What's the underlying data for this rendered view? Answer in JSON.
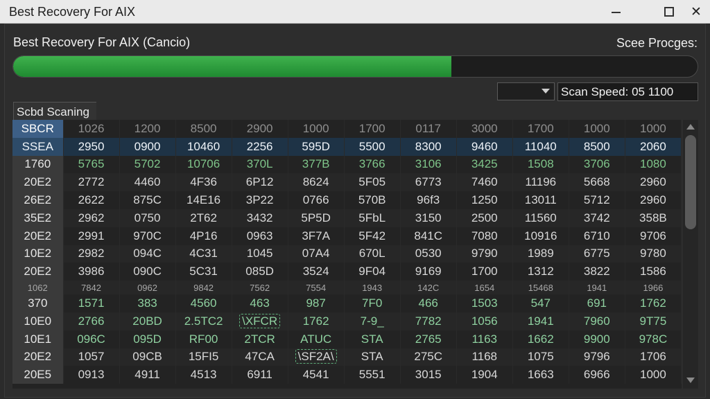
{
  "window": {
    "title": "Best Recovery For AIX",
    "controls": {
      "minimize": "minimize-icon",
      "maximize": "maximize-icon",
      "close": "close-icon"
    }
  },
  "header": {
    "app_title": "Best Recovery For AIX (Cancio)",
    "progress_label": "Scee Procges:",
    "progress_fraction": 0.64
  },
  "controls": {
    "speed_select_value": "",
    "scan_speed": "Scan Speed: 05  1100"
  },
  "section": {
    "label": "Scbd Scaning"
  },
  "grid": {
    "rows": [
      [
        "SBCR",
        "1026",
        "1200",
        "8500",
        "2900",
        "1000",
        "1700",
        "0117",
        "3000",
        "1700",
        "1000",
        "1000"
      ],
      [
        "SSEA",
        "2950",
        "0900",
        "10460",
        "2256",
        "595D",
        "5500",
        "8300",
        "9460",
        "11040",
        "8500",
        "2060"
      ],
      [
        "1760",
        "5765",
        "5702",
        "10706",
        "370L",
        "377B",
        "3766",
        "3106",
        "3425",
        "1508",
        "3706",
        "1080"
      ],
      [
        "20E2",
        "2772",
        "4460",
        "4F36",
        "6P12",
        "8624",
        "5F05",
        "6773",
        "7460",
        "11196",
        "5668",
        "2960"
      ],
      [
        "26E2",
        "2622",
        "875C",
        "14E16",
        "3P22",
        "0766",
        "570B",
        "96f3",
        "1250",
        "13011",
        "5712",
        "2960"
      ],
      [
        "35E2",
        "2962",
        "0750",
        "2T62",
        "3432",
        "5P5D",
        "5FbL",
        "3150",
        "2500",
        "11560",
        "3742",
        "358B"
      ],
      [
        "20E2",
        "2991",
        "970C",
        "4P16",
        "0963",
        "3F7A",
        "5F42",
        "841C",
        "7080",
        "10916",
        "6710",
        "9706"
      ],
      [
        "10E2",
        "2982",
        "094C",
        "4C31",
        "1045",
        "07A4",
        "670L",
        "0530",
        "9790",
        "1989",
        "6775",
        "9780"
      ],
      [
        "20E2",
        "3986",
        "090C",
        "5C31",
        "085D",
        "3524",
        "9F04",
        "9169",
        "1700",
        "1312",
        "3822",
        "1586"
      ],
      [
        "1062",
        "7842",
        "0962",
        "9842",
        "7562",
        "7554",
        "1943",
        "142C",
        "1654",
        "15468",
        "1941",
        "1966"
      ],
      [
        "370",
        "1571",
        "383",
        "4560",
        "463",
        "987",
        "7F0",
        "466",
        "1503",
        "547",
        "691",
        "1762"
      ],
      [
        "10E0",
        "2766",
        "20BD",
        "2.5TC2",
        "\\XFCR",
        "1762",
        "7-9_",
        "7782",
        "1056",
        "1941",
        "7960",
        "9T75"
      ],
      [
        "10E1",
        "096C",
        "095D",
        "RF00",
        "2TCR",
        "ATUC",
        "STA",
        "2765",
        "1163",
        "1662",
        "9900",
        "978C"
      ],
      [
        "20E2",
        "1057",
        "09CB",
        "15FI5",
        "47CA",
        "\\SF2A\\",
        "STA",
        "275C",
        "1168",
        "1075",
        "9796",
        "1706"
      ],
      [
        "20E5",
        "0913",
        "4911",
        "4513",
        "6911",
        "4541",
        "5551",
        "3015",
        "1904",
        "1663",
        "6966",
        "1000"
      ]
    ]
  },
  "scrollbar": {
    "up": "scroll-up-arrow-icon",
    "down": "scroll-down-arrow-icon"
  }
}
